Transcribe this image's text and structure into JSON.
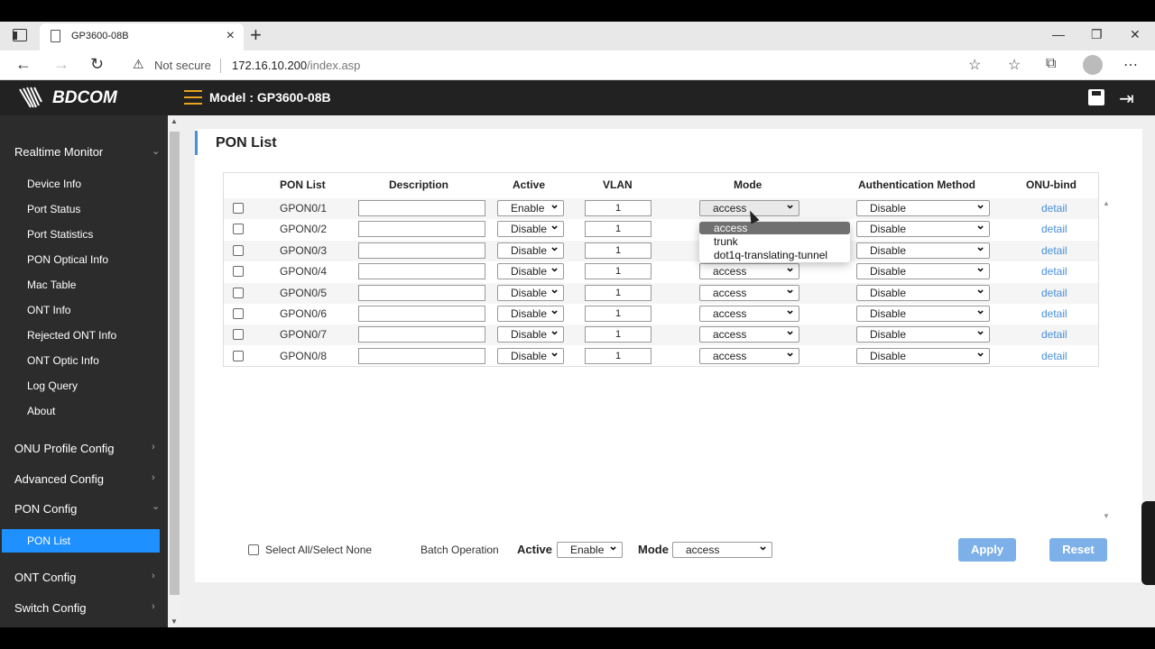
{
  "browser": {
    "tab_title": "GP3600-08B",
    "security_label": "Not secure",
    "url_host": "172.16.10.200",
    "url_path": "/index.asp"
  },
  "header": {
    "logo": "BDCOM",
    "model": "Model : GP3600-08B"
  },
  "sidebar": {
    "groups": [
      {
        "label": "Realtime Monitor"
      },
      {
        "label": "ONU Profile Config"
      },
      {
        "label": "Advanced Config"
      },
      {
        "label": "PON Config"
      },
      {
        "label": "ONT Config"
      },
      {
        "label": "Switch Config"
      }
    ],
    "monitor_items": [
      "Device Info",
      "Port Status",
      "Port Statistics",
      "PON Optical Info",
      "Mac Table",
      "ONT Info",
      "Rejected ONT Info",
      "ONT Optic Info",
      "Log Query",
      "About"
    ],
    "active_item": "PON List"
  },
  "page": {
    "title": "PON List",
    "columns": [
      "PON List",
      "Description",
      "Active",
      "VLAN",
      "Mode",
      "Authentication Method",
      "ONU-bind"
    ],
    "rows": [
      {
        "pon": "GPON0/1",
        "desc": "",
        "active": "Enable",
        "vlan": "1",
        "mode": "access",
        "auth": "Disable",
        "bind": "detail"
      },
      {
        "pon": "GPON0/2",
        "desc": "",
        "active": "Disable",
        "vlan": "1",
        "mode": "access",
        "auth": "Disable",
        "bind": "detail"
      },
      {
        "pon": "GPON0/3",
        "desc": "",
        "active": "Disable",
        "vlan": "1",
        "mode": "access",
        "auth": "Disable",
        "bind": "detail"
      },
      {
        "pon": "GPON0/4",
        "desc": "",
        "active": "Disable",
        "vlan": "1",
        "mode": "access",
        "auth": "Disable",
        "bind": "detail"
      },
      {
        "pon": "GPON0/5",
        "desc": "",
        "active": "Disable",
        "vlan": "1",
        "mode": "access",
        "auth": "Disable",
        "bind": "detail"
      },
      {
        "pon": "GPON0/6",
        "desc": "",
        "active": "Disable",
        "vlan": "1",
        "mode": "access",
        "auth": "Disable",
        "bind": "detail"
      },
      {
        "pon": "GPON0/7",
        "desc": "",
        "active": "Disable",
        "vlan": "1",
        "mode": "access",
        "auth": "Disable",
        "bind": "detail"
      },
      {
        "pon": "GPON0/8",
        "desc": "",
        "active": "Disable",
        "vlan": "1",
        "mode": "access",
        "auth": "Disable",
        "bind": "detail"
      }
    ],
    "mode_options": [
      "access",
      "trunk",
      "dot1q-translating-tunnel"
    ],
    "batch": {
      "select_all_label": "Select All/Select None",
      "batch_label": "Batch Operation",
      "active_label": "Active",
      "active_value": "Enable",
      "mode_label": "Mode",
      "mode_value": "access",
      "apply_label": "Apply",
      "reset_label": "Reset"
    }
  },
  "colors": {
    "accent": "#1e90ff",
    "link": "#4a90d9",
    "button": "#7db0e8",
    "menu_icon": "#e8a41c"
  }
}
